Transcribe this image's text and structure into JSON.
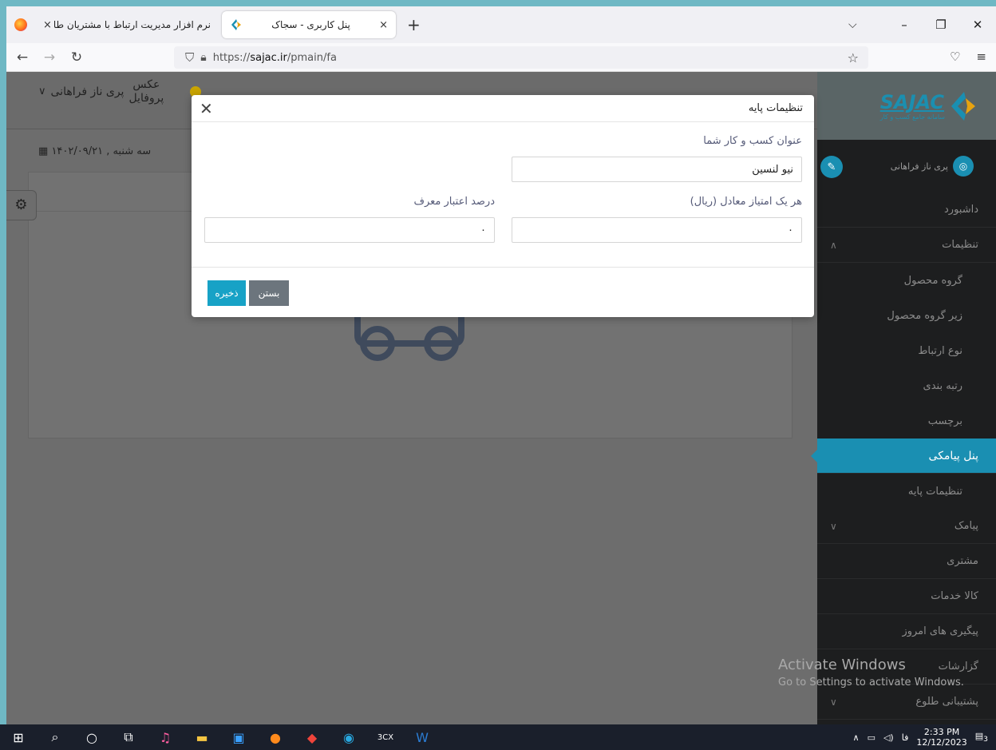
{
  "browser": {
    "tabs": [
      {
        "title": "نرم افزار مدیریت ارتباط با مشتریان طا",
        "close": "×"
      },
      {
        "title": "پنل کاربری - سجاک",
        "close": "×"
      }
    ],
    "new_tab": "+",
    "tab_list": "⌵",
    "window_controls": {
      "minimize": "–",
      "restore": "❐",
      "close": "✕"
    },
    "nav": {
      "back": "←",
      "forward": "→",
      "reload": "↻"
    },
    "url_prefix": "https://",
    "url_host": "sajac.ir",
    "url_path": "/pmain/fa",
    "star": "☆",
    "pocket": "♡",
    "menu": "≡"
  },
  "header": {
    "profile_name": "پری ناز فراهانی",
    "profile_photo_line1": "عکس",
    "profile_photo_line2": "پروفایل",
    "chevron": "∨",
    "date": "سه شنبه , ۱۴۰۲/۰۹/۲۱",
    "calendar_icon": "▦",
    "gear_icon": "⚙"
  },
  "sidebar": {
    "brand": "SAJAC",
    "brand_sub": "سامانه جامع کسب و کار",
    "user_name": "پری ناز فراهانی",
    "items": [
      {
        "label": "داشبورد",
        "arrow": ""
      },
      {
        "label": "تنظیمات",
        "arrow": "∧"
      },
      {
        "label": "گروه محصول",
        "arrow": ""
      },
      {
        "label": "زیر گروه محصول",
        "arrow": ""
      },
      {
        "label": "نوع ارتباط",
        "arrow": ""
      },
      {
        "label": "رتبه بندی",
        "arrow": ""
      },
      {
        "label": "برچسب",
        "arrow": ""
      },
      {
        "label": "پنل پیامکی",
        "arrow": ""
      },
      {
        "label": "تنظیمات پایه",
        "arrow": ""
      },
      {
        "label": "پیامک",
        "arrow": "∨"
      },
      {
        "label": "مشتری",
        "arrow": ""
      },
      {
        "label": "کالا خدمات",
        "arrow": ""
      },
      {
        "label": "پیگیری های امروز",
        "arrow": ""
      },
      {
        "label": "گزارشات",
        "arrow": ""
      },
      {
        "label": "پشتیبانی طلوع",
        "arrow": "∨"
      }
    ]
  },
  "modal": {
    "title": "تنظیمات پایه",
    "close_icon": "✕",
    "business_title_label": "عنوان کسب و کار شما",
    "business_title_value": "نیو لنسین",
    "point_value_label": "هر یک امتیاز معادل (ریال)",
    "point_value_value": "۰",
    "referrer_percent_label": "درصد اعتبار معرف",
    "referrer_percent_value": "۰",
    "close_button": "بستن",
    "save_button": "ذخیره"
  },
  "watermark": {
    "line1": "Activate Windows",
    "line2": "Go to Settings to activate Windows."
  },
  "taskbar": {
    "time": "2:33 PM",
    "date": "12/12/2023",
    "lang": "فا",
    "notif_count": "3"
  }
}
